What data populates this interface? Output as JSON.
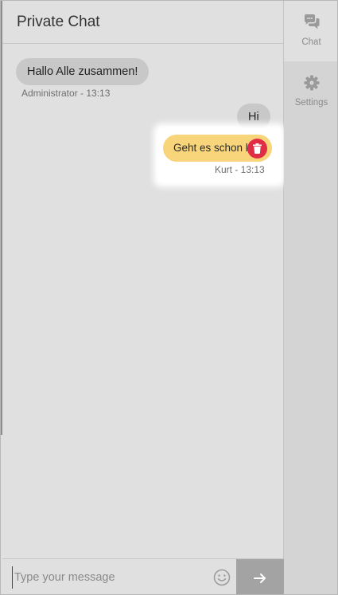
{
  "chat": {
    "title": "Private Chat",
    "messages": [
      {
        "text": "Hallo Alle zusammen!",
        "meta": "Administrator - 13:13",
        "side": "incoming"
      },
      {
        "text": "Hi",
        "side": "outgoing"
      },
      {
        "text": "Geht es schon los?",
        "visible_text": "Geht es schon lo",
        "meta": "Kurt - 13:13",
        "side": "own"
      }
    ]
  },
  "input": {
    "placeholder": "Type your message",
    "value": ""
  },
  "sidebar": {
    "tabs": [
      {
        "label": "Chat",
        "icon": "chat-bubbles-icon",
        "active": true
      },
      {
        "label": "Settings",
        "icon": "gear-icon",
        "active": false
      }
    ]
  },
  "colors": {
    "own_bubble": "#f8d47a",
    "other_bubble": "#c8c8c8",
    "delete": "#e02c44",
    "send_button": "#a3a3a3"
  }
}
